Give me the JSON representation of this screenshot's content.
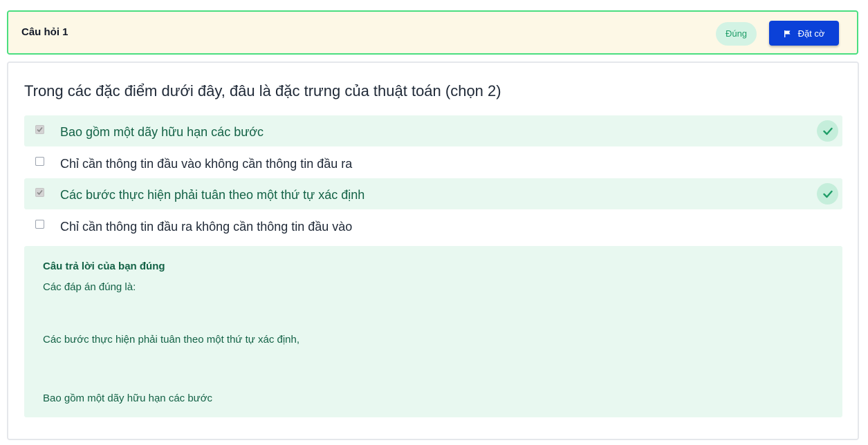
{
  "header": {
    "title": "Câu hỏi 1",
    "status": "Đúng",
    "flag_label": "Đặt cờ",
    "flag_icon": "flag-icon"
  },
  "question": {
    "text": "Trong các đặc điểm dưới đây, đâu là đặc trưng của thuật toán (chọn 2)",
    "options": [
      {
        "label": "Bao gồm một dãy hữu hạn các bước",
        "checked": true,
        "correct": true
      },
      {
        "label": "Chỉ cần thông tin đầu vào không cần thông tin đầu ra",
        "checked": false,
        "correct": false
      },
      {
        "label": "Các bước thực hiện phải tuân theo một thứ tự xác định",
        "checked": true,
        "correct": true
      },
      {
        "label": "Chỉ cần thông tin đầu ra không cần thông tin đầu vào",
        "checked": false,
        "correct": false
      }
    ]
  },
  "feedback": {
    "title": "Câu trả lời của bạn đúng",
    "intro": "Các đáp án đúng là:",
    "answers": [
      "Các bước thực hiện phải tuân theo một thứ tự xác định,",
      "Bao gồm một dãy hữu hạn các bước"
    ]
  },
  "colors": {
    "header_bg": "#fdf8e6",
    "header_border": "#4ade80",
    "correct_bg": "#e8f8f0",
    "correct_text": "#136246",
    "primary_button": "#0b41d8",
    "status_badge_bg": "#d3f3e4"
  }
}
